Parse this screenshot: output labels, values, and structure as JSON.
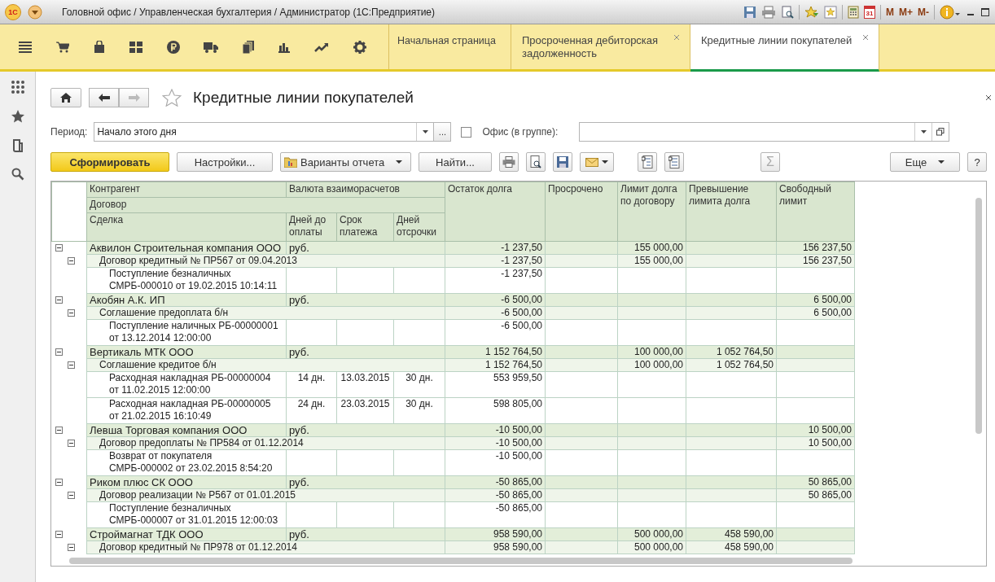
{
  "window": {
    "title": "Головной офис / Управленческая бухгалтерия / Администратор  (1С:Предприятие)",
    "app_logo": "1С",
    "calendar_day": "31",
    "memory_buttons": [
      "M",
      "M+",
      "M-"
    ]
  },
  "tabs": [
    {
      "label": "Начальная страница",
      "selected": false,
      "closable": false
    },
    {
      "label": "Просроченная дебиторская задолженность",
      "selected": false,
      "closable": true
    },
    {
      "label": "Кредитные линии покупателей",
      "selected": true,
      "closable": true
    }
  ],
  "page": {
    "title": "Кредитные линии покупателей"
  },
  "filters": {
    "period_label": "Период:",
    "period_value": "Начало этого дня",
    "choose_button": "...",
    "office_checked": false,
    "office_label": "Офис (в группе):"
  },
  "toolbar": {
    "generate": "Сформировать",
    "settings": "Настройки...",
    "variants": "Варианты отчета",
    "find": "Найти...",
    "sum": "Σ",
    "more": "Еще",
    "help": "?"
  },
  "table": {
    "columns": {
      "counterparty": "Контрагент",
      "currency": "Валюта взаиморасчетов",
      "contract": "Договор",
      "deal": "Сделка",
      "days_to_pay": "Дней до оплаты",
      "due_date": "Срок платежа",
      "delay_days": "Дней отсрочки",
      "balance": "Остаток долга",
      "overdue": "Просрочено",
      "limit": "Лимит долга по договору",
      "excess": "Превышение лимита долга",
      "free": "Свободный лимит"
    },
    "rows": [
      {
        "kind": "counterparty",
        "name": "Аквилон Строительная компания ООО",
        "currency": "руб.",
        "balance": "-1 237,50",
        "limit": "155 000,00",
        "free": "156 237,50",
        "expanded": true,
        "children": [
          {
            "kind": "contract",
            "name": "Договор кредитный № ПР567 от 09.04.2013",
            "balance": "-1 237,50",
            "limit": "155 000,00",
            "free": "156 237,50",
            "expanded": true,
            "children": [
              {
                "kind": "deal",
                "lines": [
                  "Поступление безналичных",
                  "СМРБ-000010 от 19.02.2015 10:14:11"
                ],
                "balance": "-1 237,50"
              }
            ]
          }
        ]
      },
      {
        "kind": "counterparty",
        "name": "Акобян А.К. ИП",
        "currency": "руб.",
        "balance": "-6 500,00",
        "free": "6 500,00",
        "expanded": true,
        "children": [
          {
            "kind": "contract",
            "name": "Соглашение предоплата б/н",
            "balance": "-6 500,00",
            "free": "6 500,00",
            "expanded": true,
            "children": [
              {
                "kind": "deal",
                "lines": [
                  "Поступление наличных РБ-00000001",
                  "от 13.12.2014 12:00:00"
                ],
                "balance": "-6 500,00"
              }
            ]
          }
        ]
      },
      {
        "kind": "counterparty",
        "name": "Вертикаль МТК ООО",
        "currency": "руб.",
        "balance": "1 152 764,50",
        "limit": "100 000,00",
        "excess": "1 052 764,50",
        "expanded": true,
        "children": [
          {
            "kind": "contract",
            "name": "Соглашение кредитое б/н",
            "balance": "1 152 764,50",
            "limit": "100 000,00",
            "excess": "1 052 764,50",
            "expanded": true,
            "children": [
              {
                "kind": "deal",
                "lines": [
                  "Расходная накладная РБ-00000004",
                  "от 11.02.2015 12:00:00"
                ],
                "days": "14 дн.",
                "due": "13.03.2015",
                "delay": "30 дн.",
                "balance": "553 959,50"
              },
              {
                "kind": "deal",
                "lines": [
                  "Расходная накладная РБ-00000005",
                  "от 21.02.2015 16:10:49"
                ],
                "days": "24 дн.",
                "due": "23.03.2015",
                "delay": "30 дн.",
                "balance": "598 805,00"
              }
            ]
          }
        ]
      },
      {
        "kind": "counterparty",
        "name": "Левша Торговая компания ООО",
        "currency": "руб.",
        "balance": "-10 500,00",
        "free": "10 500,00",
        "expanded": true,
        "children": [
          {
            "kind": "contract",
            "name": "Договор предоплаты № ПР584 от 01.12.2014",
            "balance": "-10 500,00",
            "free": "10 500,00",
            "expanded": true,
            "children": [
              {
                "kind": "deal",
                "lines": [
                  "Возврат от покупателя",
                  "СМРБ-000002 от 23.02.2015 8:54:20"
                ],
                "balance": "-10 500,00"
              }
            ]
          }
        ]
      },
      {
        "kind": "counterparty",
        "name": "Риком плюс СК ООО",
        "currency": "руб.",
        "balance": "-50 865,00",
        "free": "50 865,00",
        "expanded": true,
        "children": [
          {
            "kind": "contract",
            "name": "Договор реализации № Р567 от 01.01.2015",
            "balance": "-50 865,00",
            "free": "50 865,00",
            "expanded": true,
            "children": [
              {
                "kind": "deal",
                "lines": [
                  "Поступление безналичных",
                  "СМРБ-000007 от 31.01.2015 12:00:03"
                ],
                "balance": "-50 865,00"
              }
            ]
          }
        ]
      },
      {
        "kind": "counterparty",
        "name": "Строймагнат ТДК ООО",
        "currency": "руб.",
        "balance": "958 590,00",
        "limit": "500 000,00",
        "excess": "458 590,00",
        "expanded": true,
        "children": [
          {
            "kind": "contract",
            "name": "Договор кредитный № ПР978 от 01.12.2014",
            "balance": "958 590,00",
            "limit": "500 000,00",
            "excess": "458 590,00",
            "expanded": true
          }
        ]
      }
    ]
  }
}
